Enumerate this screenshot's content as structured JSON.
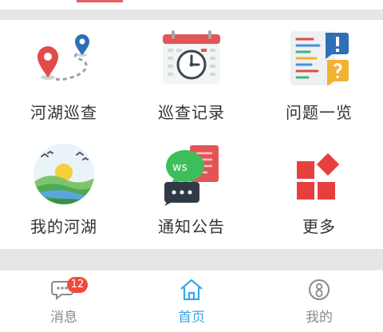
{
  "grid": {
    "items": [
      {
        "label": "河湖巡查",
        "icon": "map-route-pins-icon"
      },
      {
        "label": "巡查记录",
        "icon": "calendar-clock-icon"
      },
      {
        "label": "问题一览",
        "icon": "issue-list-icon"
      },
      {
        "label": "我的河湖",
        "icon": "river-landscape-icon"
      },
      {
        "label": "通知公告",
        "icon": "chat-notice-icon"
      },
      {
        "label": "更多",
        "icon": "more-blocks-icon"
      }
    ]
  },
  "tabbar": {
    "tabs": [
      {
        "label": "消息",
        "icon": "message-icon",
        "badge": "12"
      },
      {
        "label": "首页",
        "icon": "home-icon",
        "active": true
      },
      {
        "label": "我的",
        "icon": "profile-icon"
      }
    ]
  },
  "colors": {
    "accent": "#3aa6e8",
    "badge": "#f04a3c",
    "band": "#e6e6e6",
    "text": "#333333",
    "tab_text": "#8a8a8a"
  }
}
